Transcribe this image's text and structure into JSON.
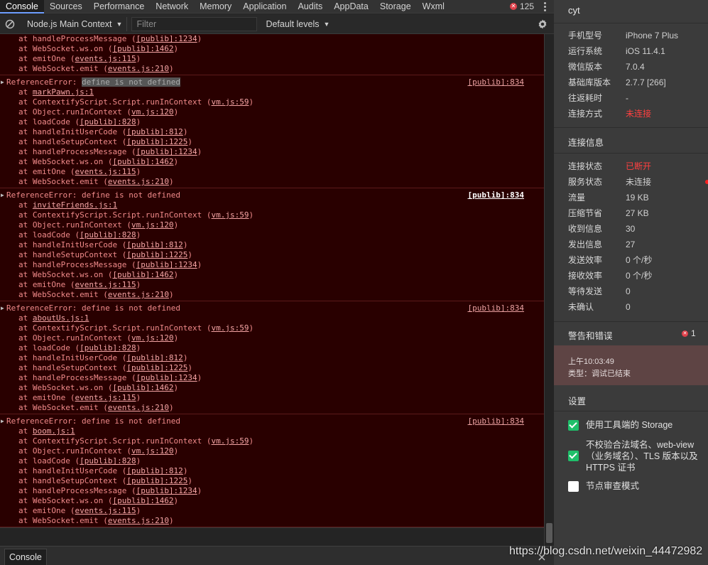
{
  "tabs": [
    {
      "label": "Console",
      "active": true
    },
    {
      "label": "Sources"
    },
    {
      "label": "Performance"
    },
    {
      "label": "Network"
    },
    {
      "label": "Memory"
    },
    {
      "label": "Application"
    },
    {
      "label": "Audits"
    },
    {
      "label": "AppData"
    },
    {
      "label": "Storage"
    },
    {
      "label": "Wxml"
    }
  ],
  "error_count": "125",
  "toolbar": {
    "context": "Node.js Main Context",
    "filter_placeholder": "Filter",
    "levels": "Default levels"
  },
  "console": {
    "top_lines": [
      {
        "pre": "at handleProcessMessage (",
        "link": "[publib]:1234",
        "post": ")"
      },
      {
        "pre": "at WebSocket.ws.on (",
        "link": "[publib]:1462",
        "post": ")"
      },
      {
        "pre": "at emitOne (",
        "link": "events.js:115",
        "post": ")"
      },
      {
        "pre": "at WebSocket.emit (",
        "link": "events.js:210",
        "post": ")"
      }
    ],
    "errors": [
      {
        "head_pre": "ReferenceError: ",
        "head_hl": "define is not defined",
        "head_rest": "",
        "source": "[publib]:834",
        "source_bold": false,
        "frames": [
          {
            "pre": "at ",
            "link": "markPawn.js:1",
            "post": ""
          },
          {
            "pre": "at ContextifyScript.Script.runInContext (",
            "link": "vm.js:59",
            "post": ")"
          },
          {
            "pre": "at Object.runInContext (",
            "link": "vm.js:120",
            "post": ")"
          },
          {
            "pre": "at loadCode (",
            "link": "[publib]:828",
            "post": ")"
          },
          {
            "pre": "at handleInitUserCode (",
            "link": "[publib]:812",
            "post": ")"
          },
          {
            "pre": "at handleSetupContext (",
            "link": "[publib]:1225",
            "post": ")"
          },
          {
            "pre": "at handleProcessMessage (",
            "link": "[publib]:1234",
            "post": ")"
          },
          {
            "pre": "at WebSocket.ws.on (",
            "link": "[publib]:1462",
            "post": ")"
          },
          {
            "pre": "at emitOne (",
            "link": "events.js:115",
            "post": ")"
          },
          {
            "pre": "at WebSocket.emit (",
            "link": "events.js:210",
            "post": ")"
          }
        ]
      },
      {
        "head_pre": "ReferenceError: ",
        "head_hl": "",
        "head_rest": "define is not defined",
        "source": "[publib]:834",
        "source_bold": true,
        "frames": [
          {
            "pre": "at ",
            "link": "inviteFriends.js:1",
            "post": ""
          },
          {
            "pre": "at ContextifyScript.Script.runInContext (",
            "link": "vm.js:59",
            "post": ")"
          },
          {
            "pre": "at Object.runInContext (",
            "link": "vm.js:120",
            "post": ")"
          },
          {
            "pre": "at loadCode (",
            "link": "[publib]:828",
            "post": ")"
          },
          {
            "pre": "at handleInitUserCode (",
            "link": "[publib]:812",
            "post": ")"
          },
          {
            "pre": "at handleSetupContext (",
            "link": "[publib]:1225",
            "post": ")"
          },
          {
            "pre": "at handleProcessMessage (",
            "link": "[publib]:1234",
            "post": ")"
          },
          {
            "pre": "at WebSocket.ws.on (",
            "link": "[publib]:1462",
            "post": ")"
          },
          {
            "pre": "at emitOne (",
            "link": "events.js:115",
            "post": ")"
          },
          {
            "pre": "at WebSocket.emit (",
            "link": "events.js:210",
            "post": ")"
          }
        ]
      },
      {
        "head_pre": "ReferenceError: ",
        "head_hl": "",
        "head_rest": "define is not defined",
        "source": "[publib]:834",
        "source_bold": false,
        "frames": [
          {
            "pre": "at ",
            "link": "aboutUs.js:1",
            "post": ""
          },
          {
            "pre": "at ContextifyScript.Script.runInContext (",
            "link": "vm.js:59",
            "post": ")"
          },
          {
            "pre": "at Object.runInContext (",
            "link": "vm.js:120",
            "post": ")"
          },
          {
            "pre": "at loadCode (",
            "link": "[publib]:828",
            "post": ")"
          },
          {
            "pre": "at handleInitUserCode (",
            "link": "[publib]:812",
            "post": ")"
          },
          {
            "pre": "at handleSetupContext (",
            "link": "[publib]:1225",
            "post": ")"
          },
          {
            "pre": "at handleProcessMessage (",
            "link": "[publib]:1234",
            "post": ")"
          },
          {
            "pre": "at WebSocket.ws.on (",
            "link": "[publib]:1462",
            "post": ")"
          },
          {
            "pre": "at emitOne (",
            "link": "events.js:115",
            "post": ")"
          },
          {
            "pre": "at WebSocket.emit (",
            "link": "events.js:210",
            "post": ")"
          }
        ]
      },
      {
        "head_pre": "ReferenceError: ",
        "head_hl": "",
        "head_rest": "define is not defined",
        "source": "[publib]:834",
        "source_bold": false,
        "frames": [
          {
            "pre": "at ",
            "link": "boom.js:1",
            "post": ""
          },
          {
            "pre": "at ContextifyScript.Script.runInContext (",
            "link": "vm.js:59",
            "post": ")"
          },
          {
            "pre": "at Object.runInContext (",
            "link": "vm.js:120",
            "post": ")"
          },
          {
            "pre": "at loadCode (",
            "link": "[publib]:828",
            "post": ")"
          },
          {
            "pre": "at handleInitUserCode (",
            "link": "[publib]:812",
            "post": ")"
          },
          {
            "pre": "at handleSetupContext (",
            "link": "[publib]:1225",
            "post": ")"
          },
          {
            "pre": "at handleProcessMessage (",
            "link": "[publib]:1234",
            "post": ")"
          },
          {
            "pre": "at WebSocket.ws.on (",
            "link": "[publib]:1462",
            "post": ")"
          },
          {
            "pre": "at emitOne (",
            "link": "events.js:115",
            "post": ")"
          },
          {
            "pre": "at WebSocket.emit (",
            "link": "events.js:210",
            "post": ")"
          }
        ]
      }
    ]
  },
  "drawer": {
    "tab_label": "Console"
  },
  "info": {
    "device_name": "cyt",
    "device_rows": [
      {
        "key": "手机型号",
        "value": "iPhone 7 Plus"
      },
      {
        "key": "运行系统",
        "value": "iOS 11.4.1"
      },
      {
        "key": "微信版本",
        "value": "7.0.4"
      },
      {
        "key": "基础库版本",
        "value": "2.7.7 [266]"
      },
      {
        "key": "往返耗时",
        "value": "-"
      },
      {
        "key": "连接方式",
        "value": "未连接",
        "red": true
      }
    ],
    "connection_title": "连接信息",
    "connection_rows": [
      {
        "key": "连接状态",
        "value": "已断开",
        "red": true
      },
      {
        "key": "服务状态",
        "value": "未连接",
        "dot": true
      },
      {
        "key": "流量",
        "value": "19 KB"
      },
      {
        "key": "压缩节省",
        "value": "27 KB"
      },
      {
        "key": "收到信息",
        "value": "30"
      },
      {
        "key": "发出信息",
        "value": "27"
      },
      {
        "key": "发送效率",
        "value": "0 个/秒"
      },
      {
        "key": "接收效率",
        "value": "0 个/秒"
      },
      {
        "key": "等待发送",
        "value": "0"
      },
      {
        "key": "未确认",
        "value": "0"
      }
    ],
    "warnings_title": "警告和错误",
    "warnings_count": "1",
    "log": {
      "time": "上午10:03:49",
      "type": "类型：调试已结束"
    },
    "settings_title": "设置",
    "settings": [
      {
        "label": "使用工具端的 Storage",
        "checked": true
      },
      {
        "label": "不校验合法域名、web-view（业务域名）、TLS 版本以及 HTTPS 证书",
        "checked": true
      },
      {
        "label": "节点审查模式",
        "checked": false
      }
    ]
  },
  "watermark": "https://blog.csdn.net/weixin_44472982",
  "colors": {
    "error_bg": "#290000",
    "error_text": "#f08a8a",
    "accent_red": "#ff4040",
    "check_green": "#1fbf6a"
  }
}
